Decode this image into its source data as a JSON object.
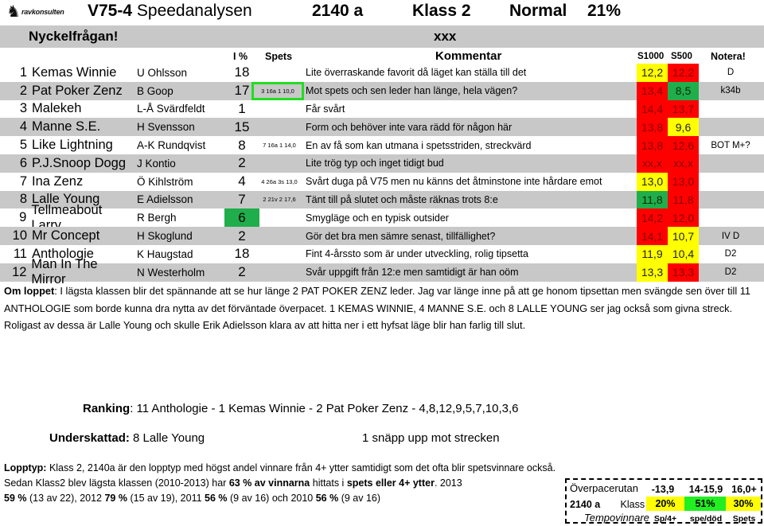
{
  "header": {
    "logo_text": "ravkonsulten",
    "logo_icon": "horse-icon",
    "race_code": "V75-4",
    "title": "Speedanalysen",
    "distance": "2140 a",
    "klass": "Klass 2",
    "tempo": "Normal",
    "percent": "21%"
  },
  "keyquestion": {
    "label": "Nyckelfrågan!",
    "value": "xxx"
  },
  "columns": {
    "ip": "I %",
    "spets": "Spets",
    "comment": "Kommentar",
    "s1000": "S1000",
    "s500": "S500",
    "note": "Notera!"
  },
  "colors": {
    "yellow": "#ffff00",
    "red": "#ff0000",
    "green": "#1fae4b",
    "highlight_box": "#22dd22",
    "stripe": "#c8c8c8"
  },
  "horses": [
    {
      "num": "1",
      "name": "Kemas Winnie",
      "driver": "U Ohlsson",
      "ip": "18",
      "spets": "",
      "comment": "Lite överraskande favorit då läget kan ställa till det",
      "s1000": "12,2",
      "s1000_color": "yellow",
      "s500": "12,2",
      "s500_color": "red",
      "note": "D"
    },
    {
      "num": "2",
      "name": "Pat Poker Zenz",
      "driver": "B Goop",
      "ip": "17",
      "spets": "3 16a 1 10,0",
      "spets_boxed": true,
      "comment": "Mot spets och sen leder han länge, hela vägen?",
      "s1000": "13,4",
      "s1000_color": "red",
      "s500": "8,5",
      "s500_color": "green",
      "note": "k34b"
    },
    {
      "num": "3",
      "name": "Malekeh",
      "driver": "L-Å Svärdfeldt",
      "ip": "1",
      "spets": "",
      "comment": "Får svårt",
      "s1000": "14,4",
      "s1000_color": "red",
      "s500": "13,7",
      "s500_color": "red",
      "note": ""
    },
    {
      "num": "4",
      "name": "Manne S.E.",
      "driver": "H Svensson",
      "ip": "15",
      "spets": "",
      "comment": "Form och behöver inte vara rädd för någon här",
      "s1000": "13,8",
      "s1000_color": "red",
      "s500": "9,6",
      "s500_color": "yellow",
      "note": ""
    },
    {
      "num": "5",
      "name": "Like Lightning",
      "driver": "A-K Rundqvist",
      "ip": "8",
      "spets": "7 16a 1 14,0",
      "comment": "En av få som kan utmana i spetsstriden, streckvärd",
      "s1000": "13,8",
      "s1000_color": "red",
      "s500": "12,6",
      "s500_color": "red",
      "note": "BOT M+?"
    },
    {
      "num": "6",
      "name": "P.J.Snoop Dogg",
      "driver": "J Kontio",
      "ip": "2",
      "spets": "",
      "comment": "Lite trög typ och inget tidigt bud",
      "s1000": "xx,x",
      "s1000_color": "red",
      "s500": "xx,x",
      "s500_color": "red",
      "note": ""
    },
    {
      "num": "7",
      "name": "Ina Zenz",
      "driver": "Ö Kihlström",
      "ip": "4",
      "spets": "4 26a 3s 13,0",
      "comment": "Svårt duga på V75 men nu känns det åtminstone inte hårdare emot",
      "s1000": "13,0",
      "s1000_color": "yellow",
      "s500": "13,0",
      "s500_color": "red",
      "note": ""
    },
    {
      "num": "8",
      "name": "Lalle Young",
      "driver": "E Adielsson",
      "ip": "7",
      "spets": "2 21v 2 17,6",
      "comment": "Tänt till på slutet och måste räknas trots 8:e",
      "s1000": "11,8",
      "s1000_color": "green",
      "s500": "11,8",
      "s500_color": "red",
      "note": ""
    },
    {
      "num": "9",
      "name": "Tellmeabout Larry",
      "driver": "R Bergh",
      "ip": "6",
      "ip_green": true,
      "spets": "",
      "comment": "Smygläge och en typisk outsider",
      "s1000": "14,2",
      "s1000_color": "red",
      "s500": "12,0",
      "s500_color": "red",
      "note": ""
    },
    {
      "num": "10",
      "name": "Mr Concept",
      "driver": "H Skoglund",
      "ip": "2",
      "spets": "",
      "comment": "Gör det bra men sämre senast, tillfällighet?",
      "s1000": "14,1",
      "s1000_color": "red",
      "s500": "10,7",
      "s500_color": "yellow",
      "note": "IV D"
    },
    {
      "num": "11",
      "name": "Anthologie",
      "driver": "K Haugstad",
      "ip": "18",
      "spets": "",
      "comment": "Fint 4-årssto som är under utveckling, rolig tipsetta",
      "s1000": "11,9",
      "s1000_color": "yellow",
      "s500": "10,4",
      "s500_color": "yellow",
      "note": "D2"
    },
    {
      "num": "12",
      "name": "Man In The Mirror",
      "driver": "N Westerholm",
      "ip": "2",
      "spets": "",
      "comment": "Svår uppgift från 12:e men samtidigt är han oöm",
      "s1000": "13,3",
      "s1000_color": "yellow",
      "s500": "13,3",
      "s500_color": "red",
      "note": "D2"
    }
  ],
  "om_loppet": {
    "label": "Om loppet",
    "text": ": I lägsta klassen blir det spännande att se hur länge 2 PAT POKER ZENZ leder. Jag var länge inne på att ge honom tipsettan men svängde sen över till 11 ANTHOLOGIE som borde kunna dra nytta av det förväntade överpacet. 1 KEMAS WINNIE, 4 MANNE S.E. och 8 LALLE YOUNG ser jag också som givna streck. Roligast av dessa är Lalle Young och skulle Erik Adielsson klara av att hitta ner i ett hyfsat läge blir han farlig till slut."
  },
  "ranking": {
    "label": "Ranking",
    "value": ": 11 Anthologie - 1 Kemas Winnie - 2 Pat Poker Zenz - 4,8,12,9,5,7,10,3,6"
  },
  "underskattad": {
    "label": "Underskattad:",
    "value": " 8 Lalle Young",
    "note": "1 snäpp upp mot strecken"
  },
  "lopptyp": {
    "label": "Lopptyp:",
    "t1": " Klass 2, 2140a är den lopptyp med högst andel vinnare från 4+ ytter samtidigt som det ofta blir spetsvinnare också. Sedan Klass2 blev lägsta klassen (2010-2013) har ",
    "b1": "63 % av vinnarna",
    "t2": " hittats i ",
    "b2": "spets eller 4+ ytter",
    "t3": ". 2013 ",
    "b3": "59 %",
    "t4": " (13 av 22), 2012 ",
    "b4": "79 %",
    "t5": " (15 av 19), 2011 ",
    "b5": "56 %",
    "t6": " (9 av 16) och 2010 ",
    "b6": "56 %",
    "t7": " (9 av 16)"
  },
  "overpace": {
    "title": "Överpacerutan",
    "h1": "-13,9",
    "h2": "14-15,9",
    "h3": "16,0+",
    "distance": "2140 a",
    "klass": "Klass 2",
    "v1": "20%",
    "v2": "51%",
    "v3": "30%",
    "tempo_label": "Tempovinnare",
    "l1": "Sp/4+",
    "l2": "spe/död",
    "l3": "Spets"
  }
}
